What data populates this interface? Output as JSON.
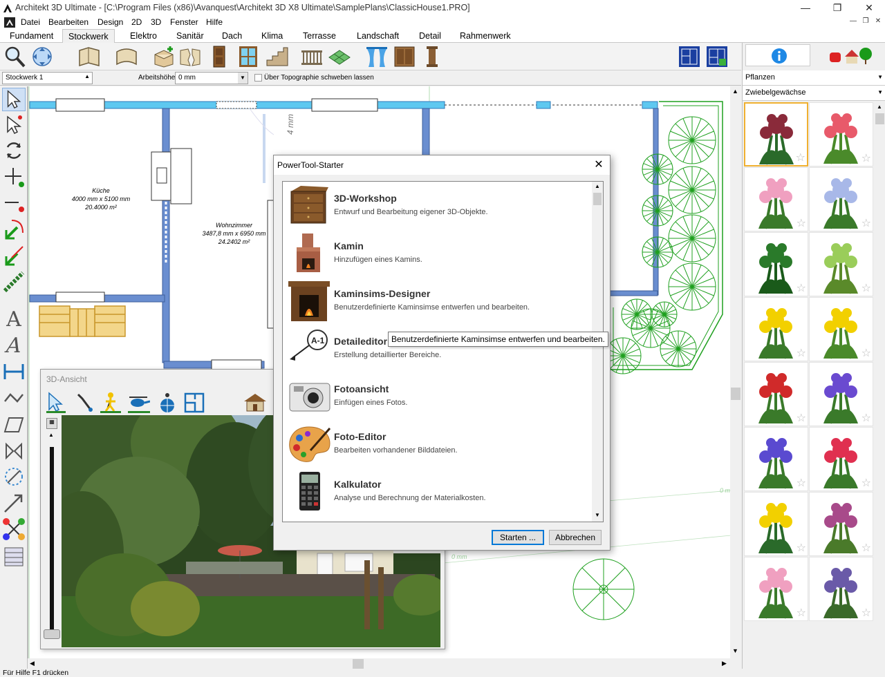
{
  "window": {
    "title": "Architekt 3D Ultimate - [C:\\Program Files (x86)\\Avanquest\\Architekt 3D X8 Ultimate\\SamplePlans\\ClassicHouse1.PRO]"
  },
  "menu": [
    "Datei",
    "Bearbeiten",
    "Design",
    "2D",
    "3D",
    "Fenster",
    "Hilfe"
  ],
  "tabs": [
    "Fundament",
    "Stockwerk",
    "Elektro",
    "Sanitär",
    "Dach",
    "Klima",
    "Terrasse",
    "Landschaft",
    "Detail",
    "Rahmenwerk"
  ],
  "active_tab": "Stockwerk",
  "options": {
    "floor": "Stockwerk 1",
    "height_label": "Arbeitshöhe:",
    "height_value": "0 mm",
    "topo_label": "Über Topographie schweben lassen"
  },
  "plan": {
    "room1": {
      "name": "Küche",
      "dims": "4000 mm x 5100 mm",
      "area": "20.4000 m²"
    },
    "room2": {
      "name": "Wohnzimmer",
      "dims": "3487,8 mm x 6950 mm",
      "area": "24.2402 m²"
    },
    "dim_vertical": "4 mm",
    "dim_small_1": "0 mm",
    "dim_small_2": "0 mm"
  },
  "right_panel": {
    "category": "Pflanzen",
    "subcategory": "Zwiebelgewächse"
  },
  "view3d": {
    "title": "3D-Ansicht"
  },
  "dialog": {
    "title": "PowerTool-Starter",
    "items": [
      {
        "title": "3D-Workshop",
        "desc": "Entwurf und Bearbeitung eigener 3D-Objekte."
      },
      {
        "title": "Kamin",
        "desc": "Hinzufügen eines Kamins."
      },
      {
        "title": "Kaminsims-Designer",
        "desc": "Benutzerdefinierte Kaminsimse entwerfen und bearbeiten."
      },
      {
        "title": "Detaileditor",
        "desc": "Erstellung detaillierter Bereiche."
      },
      {
        "title": "Fotoansicht",
        "desc": "Einfügen eines Fotos."
      },
      {
        "title": "Foto-Editor",
        "desc": "Bearbeiten vorhandener Bilddateien."
      },
      {
        "title": "Kalkulator",
        "desc": "Analyse und Berechnung der Materialkosten."
      }
    ],
    "start_label": "Starten ...",
    "cancel_label": "Abbrechen",
    "tooltip": "Benutzerdefinierte Kaminsimse entwerfen und bearbeiten."
  },
  "status": "Für Hilfe F1 drücken",
  "colors": {
    "wall": "#6a8ed0",
    "window": "#5ec8f0",
    "landscape": "#1fa01f",
    "furniture": "#c8962a",
    "accent": "#1e88e5"
  }
}
